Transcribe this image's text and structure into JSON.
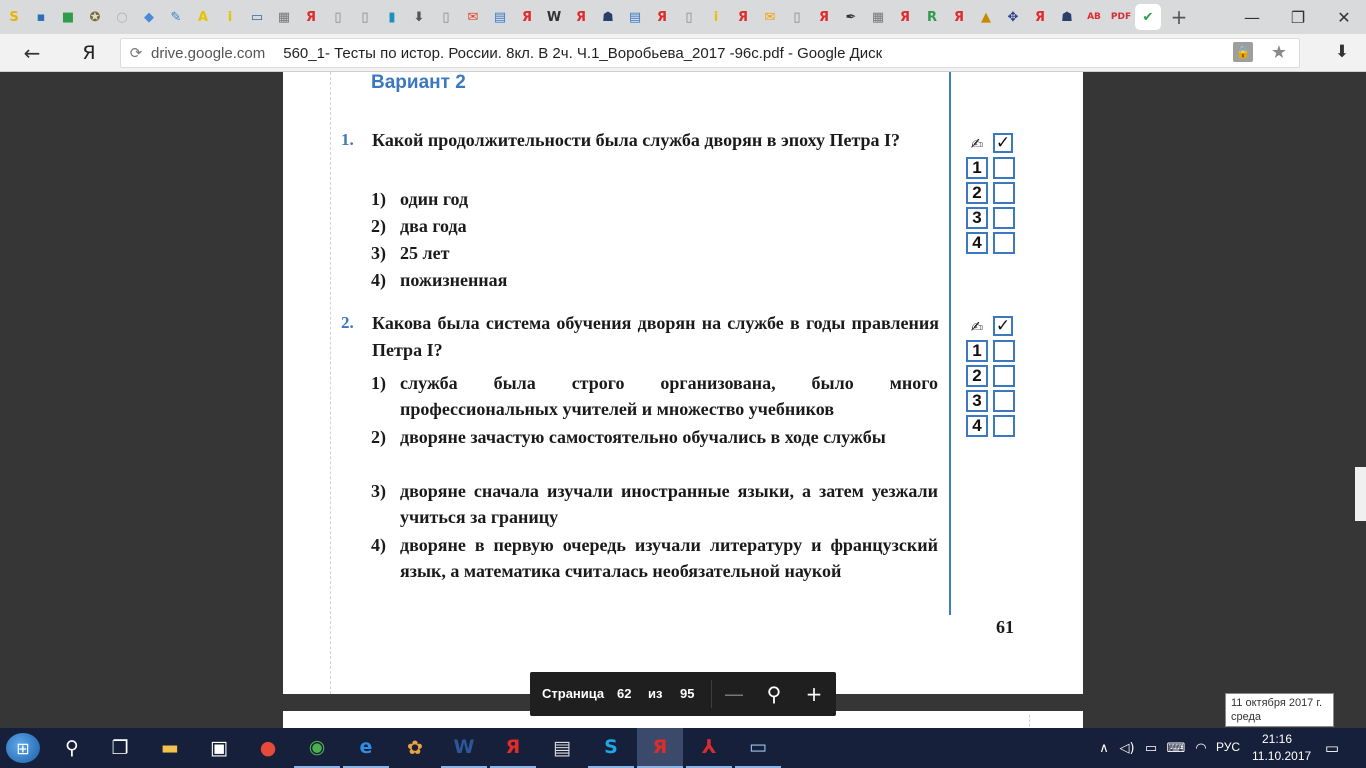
{
  "browser": {
    "bookmark_icons": [
      {
        "name": "bookmark-s-icon",
        "glyph": "S",
        "color": "#e8b200"
      },
      {
        "name": "bookmark-chat-icon",
        "glyph": "▪",
        "color": "#2c6fb7"
      },
      {
        "name": "bookmark-gift-icon",
        "glyph": "■",
        "color": "#2e9c4a"
      },
      {
        "name": "bookmark-globe-icon",
        "glyph": "✪",
        "color": "#7d6a2c"
      },
      {
        "name": "bookmark-circle-icon",
        "glyph": "○",
        "color": "#b0b0b0"
      },
      {
        "name": "bookmark-pin-icon",
        "glyph": "◆",
        "color": "#4a8ad6"
      },
      {
        "name": "bookmark-tools-icon",
        "glyph": "✎",
        "color": "#3c7fcf"
      },
      {
        "name": "bookmark-a-icon",
        "glyph": "A",
        "color": "#e7c200"
      },
      {
        "name": "bookmark-i-icon",
        "glyph": "i",
        "color": "#e7c200"
      },
      {
        "name": "bookmark-monitor-icon",
        "glyph": "▭",
        "color": "#2d67b1"
      },
      {
        "name": "bookmark-presentation-icon",
        "glyph": "▦",
        "color": "#777777"
      },
      {
        "name": "bookmark-yandex-icon",
        "glyph": "Я",
        "color": "#e02b2b"
      },
      {
        "name": "bookmark-doc-icon",
        "glyph": "▯",
        "color": "#888888"
      },
      {
        "name": "bookmark-doc2-icon",
        "glyph": "▯",
        "color": "#888888"
      },
      {
        "name": "bookmark-book-icon",
        "glyph": "▮",
        "color": "#1e8fbf"
      },
      {
        "name": "bookmark-download-icon",
        "glyph": "⬇",
        "color": "#555555"
      },
      {
        "name": "bookmark-doc3-icon",
        "glyph": "▯",
        "color": "#888888"
      },
      {
        "name": "bookmark-mail-icon",
        "glyph": "✉",
        "color": "#e0442c"
      },
      {
        "name": "bookmark-file-icon",
        "glyph": "▤",
        "color": "#3a7ac9"
      },
      {
        "name": "bookmark-yandex2-icon",
        "glyph": "Я",
        "color": "#e02b2b"
      },
      {
        "name": "bookmark-wikipedia-icon",
        "glyph": "W",
        "color": "#333333"
      },
      {
        "name": "bookmark-yandex3-icon",
        "glyph": "Я",
        "color": "#e02b2b"
      },
      {
        "name": "bookmark-person-icon",
        "glyph": "☗",
        "color": "#2b3e6b"
      },
      {
        "name": "bookmark-file2-icon",
        "glyph": "▤",
        "color": "#3a7ac9"
      },
      {
        "name": "bookmark-yandex4-icon",
        "glyph": "Я",
        "color": "#e02b2b"
      },
      {
        "name": "bookmark-doc4-icon",
        "glyph": "▯",
        "color": "#888888"
      },
      {
        "name": "bookmark-i2-icon",
        "glyph": "i",
        "color": "#e7c200"
      },
      {
        "name": "bookmark-yandex5-icon",
        "glyph": "Я",
        "color": "#e02b2b"
      },
      {
        "name": "bookmark-envelope-icon",
        "glyph": "✉",
        "color": "#f2a200"
      },
      {
        "name": "bookmark-doc5-icon",
        "glyph": "▯",
        "color": "#888888"
      },
      {
        "name": "bookmark-yandex6-icon",
        "glyph": "Я",
        "color": "#e02b2b"
      },
      {
        "name": "bookmark-quill-icon",
        "glyph": "✒",
        "color": "#333333"
      },
      {
        "name": "bookmark-presentation2-icon",
        "glyph": "▦",
        "color": "#777777"
      },
      {
        "name": "bookmark-yandex7-icon",
        "glyph": "Я",
        "color": "#e02b2b"
      },
      {
        "name": "bookmark-r-icon",
        "glyph": "R",
        "color": "#2e9c4a"
      },
      {
        "name": "bookmark-yandex8-icon",
        "glyph": "Я",
        "color": "#e02b2b"
      },
      {
        "name": "bookmark-photo-icon",
        "glyph": "▲",
        "color": "#c98a00"
      },
      {
        "name": "bookmark-puzzle-icon",
        "glyph": "✥",
        "color": "#2d3f8a"
      },
      {
        "name": "bookmark-yandex9-icon",
        "glyph": "Я",
        "color": "#e02b2b"
      },
      {
        "name": "bookmark-person2-icon",
        "glyph": "☗",
        "color": "#2b3e6b"
      },
      {
        "name": "bookmark-ab-icon",
        "glyph": "AB",
        "color": "#e02b2b"
      },
      {
        "name": "bookmark-pdf-icon",
        "glyph": "PDF",
        "color": "#d32f2f"
      },
      {
        "name": "bookmark-check-icon",
        "glyph": "✔",
        "color": "#2e9c4a"
      }
    ],
    "newtab_glyph": "+",
    "minimize_glyph": "—",
    "restore_glyph": "❐",
    "close_glyph": "✕",
    "back_glyph": "←",
    "yandex_glyph": "Я",
    "url_icon_glyph": "⟳",
    "url_domain": "drive.google.com",
    "page_title": "560_1- Тесты по истор. России. 8кл. В 2ч. Ч.1_Воробьева_2017 -96с.pdf - Google Диск",
    "lock_glyph": "🔒",
    "star_glyph": "★",
    "download_glyph": "⬇"
  },
  "document": {
    "variant_title": "Вариант 2",
    "page_number": "61",
    "questions": [
      {
        "number": "1.",
        "text": "Какой продолжительности была служба дворян в эпоху Петра I?",
        "options": [
          {
            "num": "1)",
            "text": "один год"
          },
          {
            "num": "2)",
            "text": "два года"
          },
          {
            "num": "3)",
            "text": "25 лет"
          },
          {
            "num": "4)",
            "text": "пожизненная"
          }
        ],
        "answer_boxes": [
          "1",
          "2",
          "3",
          "4"
        ]
      },
      {
        "number": "2.",
        "text": "Какова была система обучения дворян на службе в годы правления Петра I?",
        "options": [
          {
            "num": "1)",
            "text": "служба была строго организована, было много профессиональных учителей и множество учебников"
          },
          {
            "num": "2)",
            "text": "дворяне зачастую самостоятельно обучались в ходе службы"
          },
          {
            "num": "3)",
            "text": "дворяне сначала изучали иностранные языки, а затем уезжали учиться за границу"
          },
          {
            "num": "4)",
            "text": "дворяне в первую очередь изучали литературу и французский язык, а математика считалась необязательной наукой"
          }
        ],
        "answer_boxes": [
          "1",
          "2",
          "3",
          "4"
        ]
      }
    ],
    "pen_glyph": "✍",
    "check_glyph": "✓"
  },
  "pagebar": {
    "label": "Страница",
    "current": "62",
    "of": "из",
    "total": "95",
    "zoom_out_glyph": "—",
    "zoom_glyph": "⚲",
    "zoom_in_glyph": "+"
  },
  "tooltip": {
    "date": "11 октября 2017 г.",
    "weekday": "среда"
  },
  "taskbar": {
    "start_glyph": "⊞",
    "search_glyph": "⚲",
    "taskview_glyph": "❐",
    "apps": [
      {
        "name": "file-explorer-icon",
        "glyph": "▬",
        "color": "#f2c14e"
      },
      {
        "name": "store-icon",
        "glyph": "▣",
        "color": "#ffffff"
      },
      {
        "name": "paint-icon",
        "glyph": "●",
        "color": "#e84a3a"
      },
      {
        "name": "chrome-icon",
        "glyph": "◉",
        "color": "#4caf50"
      },
      {
        "name": "edge-icon",
        "glyph": "e",
        "color": "#2f8ee0"
      },
      {
        "name": "palette-icon",
        "glyph": "✿",
        "color": "#e8a33a"
      },
      {
        "name": "word-icon",
        "glyph": "W",
        "color": "#2b5797"
      },
      {
        "name": "yandex-app-icon",
        "glyph": "Я",
        "color": "#e02b2b"
      },
      {
        "name": "printer-icon",
        "glyph": "▤",
        "color": "#dddddd"
      },
      {
        "name": "skype-icon",
        "glyph": "S",
        "color": "#1ea6e6"
      },
      {
        "name": "yandex-browser-icon",
        "glyph": "Я",
        "color": "#e02b2b"
      },
      {
        "name": "acrobat-icon",
        "glyph": "⅄",
        "color": "#d32f2f"
      },
      {
        "name": "monitor-app-icon",
        "glyph": "▭",
        "color": "#9cc3ee"
      }
    ],
    "tray": {
      "chevron_glyph": "∧",
      "volume_glyph": "◁)",
      "battery_glyph": "▭",
      "keyboard_glyph": "⌨",
      "wifi_glyph": "◠",
      "language": "РУС",
      "time": "21:16",
      "date": "11.10.2017",
      "notification_glyph": "▭"
    }
  }
}
